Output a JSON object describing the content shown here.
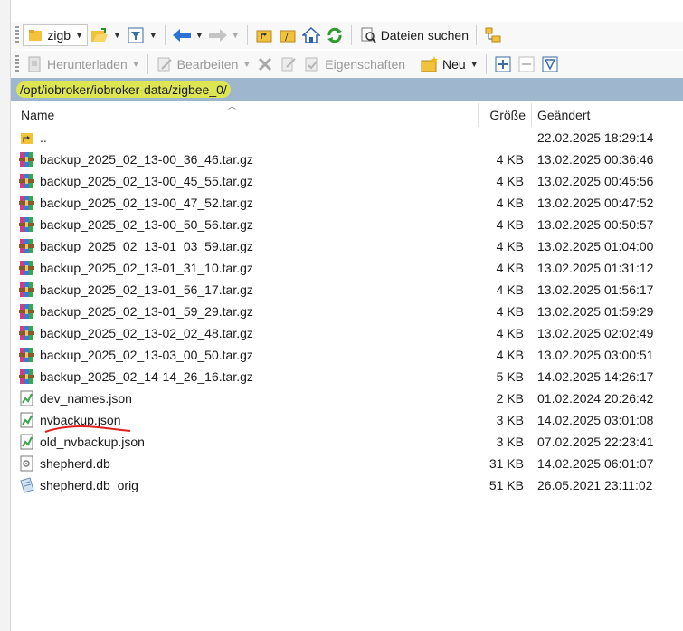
{
  "toolbar1": {
    "combo_value": "zigb",
    "search_label": "Dateien suchen"
  },
  "toolbar2": {
    "download_label": "Herunterladen",
    "edit_label": "Bearbeiten",
    "properties_label": "Eigenschaften",
    "new_label": "Neu"
  },
  "path": "/opt/iobroker/iobroker-data/zigbee_0/",
  "columns": {
    "name": "Name",
    "size": "Größe",
    "modified": "Geändert"
  },
  "files": [
    {
      "name": "..",
      "size": "",
      "modified": "22.02.2025 18:29:14",
      "icon": "parent-folder-icon"
    },
    {
      "name": "backup_2025_02_13-00_36_46.tar.gz",
      "size": "4 KB",
      "modified": "13.02.2025 00:36:46",
      "icon": "archive-icon"
    },
    {
      "name": "backup_2025_02_13-00_45_55.tar.gz",
      "size": "4 KB",
      "modified": "13.02.2025 00:45:56",
      "icon": "archive-icon"
    },
    {
      "name": "backup_2025_02_13-00_47_52.tar.gz",
      "size": "4 KB",
      "modified": "13.02.2025 00:47:52",
      "icon": "archive-icon"
    },
    {
      "name": "backup_2025_02_13-00_50_56.tar.gz",
      "size": "4 KB",
      "modified": "13.02.2025 00:50:57",
      "icon": "archive-icon"
    },
    {
      "name": "backup_2025_02_13-01_03_59.tar.gz",
      "size": "4 KB",
      "modified": "13.02.2025 01:04:00",
      "icon": "archive-icon"
    },
    {
      "name": "backup_2025_02_13-01_31_10.tar.gz",
      "size": "4 KB",
      "modified": "13.02.2025 01:31:12",
      "icon": "archive-icon"
    },
    {
      "name": "backup_2025_02_13-01_56_17.tar.gz",
      "size": "4 KB",
      "modified": "13.02.2025 01:56:17",
      "icon": "archive-icon"
    },
    {
      "name": "backup_2025_02_13-01_59_29.tar.gz",
      "size": "4 KB",
      "modified": "13.02.2025 01:59:29",
      "icon": "archive-icon"
    },
    {
      "name": "backup_2025_02_13-02_02_48.tar.gz",
      "size": "4 KB",
      "modified": "13.02.2025 02:02:49",
      "icon": "archive-icon"
    },
    {
      "name": "backup_2025_02_13-03_00_50.tar.gz",
      "size": "4 KB",
      "modified": "13.02.2025 03:00:51",
      "icon": "archive-icon"
    },
    {
      "name": "backup_2025_02_14-14_26_16.tar.gz",
      "size": "5 KB",
      "modified": "14.02.2025 14:26:17",
      "icon": "archive-icon"
    },
    {
      "name": "dev_names.json",
      "size": "2 KB",
      "modified": "01.02.2024 20:26:42",
      "icon": "json-file-icon"
    },
    {
      "name": "nvbackup.json",
      "size": "3 KB",
      "modified": "14.02.2025 03:01:08",
      "icon": "json-file-icon"
    },
    {
      "name": "old_nvbackup.json",
      "size": "3 KB",
      "modified": "07.02.2025 22:23:41",
      "icon": "json-file-icon"
    },
    {
      "name": "shepherd.db",
      "size": "31 KB",
      "modified": "14.02.2025 06:01:07",
      "icon": "db-file-icon"
    },
    {
      "name": "shepherd.db_orig",
      "size": "51 KB",
      "modified": "26.05.2021 23:11:02",
      "icon": "generic-file-icon"
    }
  ],
  "colors": {
    "pathbar": "#9fb6cf",
    "highlight": "#e8ee3c",
    "annotation": "#e02020"
  }
}
